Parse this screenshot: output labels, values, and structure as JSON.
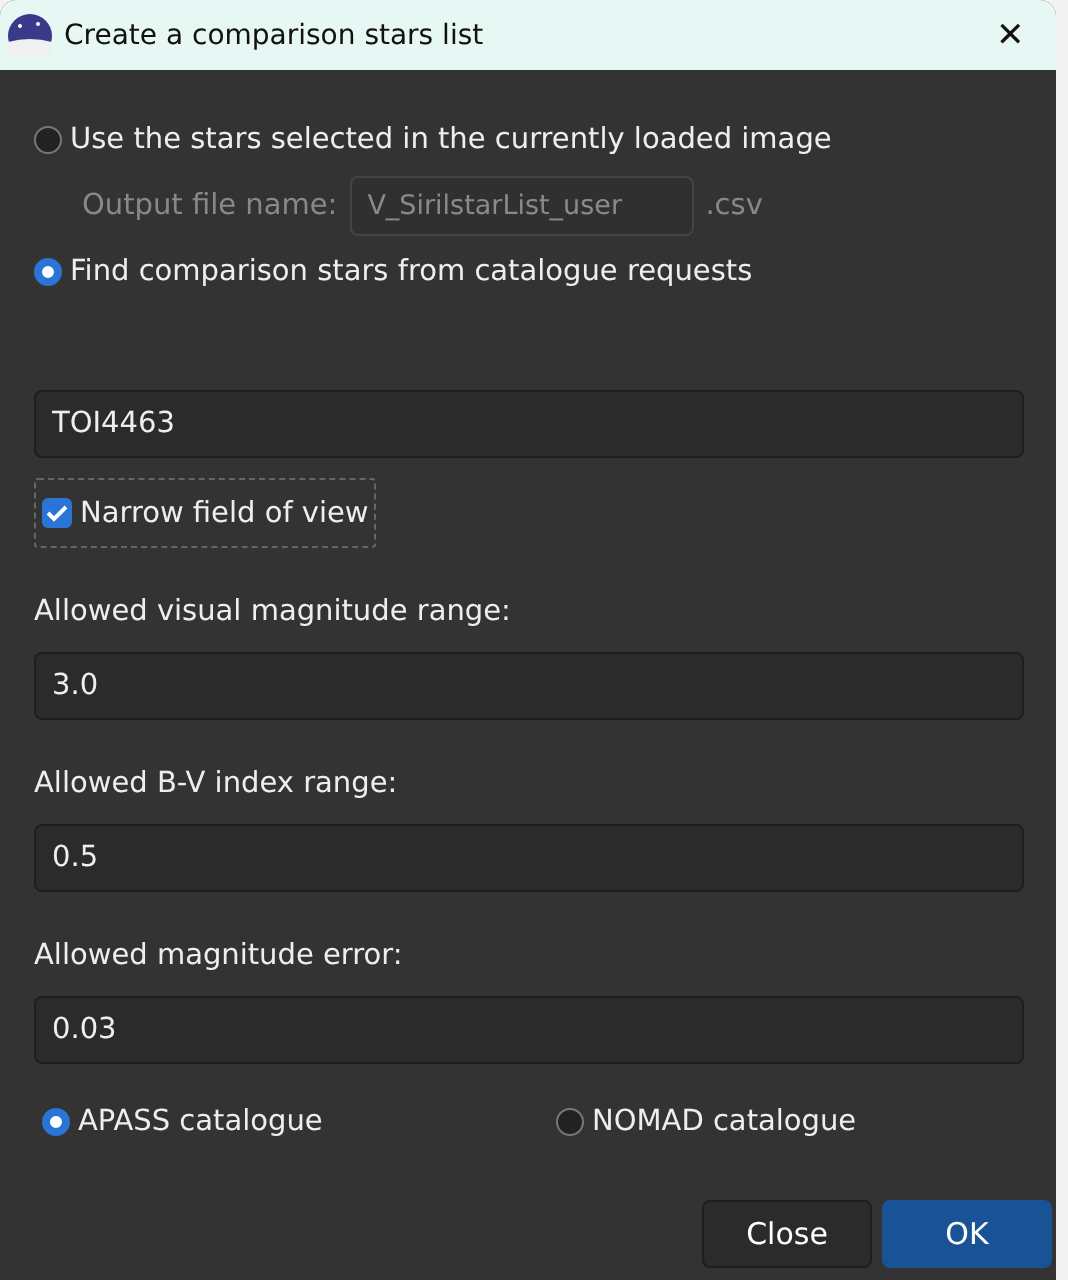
{
  "window": {
    "title": "Create a comparison stars list",
    "close": "✕"
  },
  "source_options": [
    {
      "label": "Use the stars selected in the currently loaded image",
      "selected": false
    },
    {
      "label": "Find comparison stars from catalogue requests",
      "selected": true
    }
  ],
  "output_file": {
    "label": "Output file name:",
    "value": "V_SirilstarList_user",
    "suffix": ".csv",
    "disabled": true
  },
  "target": {
    "value": "TOI4463"
  },
  "narrow_field": {
    "label": "Narrow field of view",
    "checked": true
  },
  "parameters": [
    {
      "label": "Allowed visual magnitude range:",
      "value": "3.0"
    },
    {
      "label": "Allowed B-V index range:",
      "value": "0.5"
    },
    {
      "label": "Allowed magnitude error:",
      "value": "0.03"
    }
  ],
  "catalogues": [
    {
      "label": "APASS catalogue",
      "selected": true
    },
    {
      "label": "NOMAD catalogue",
      "selected": false
    }
  ],
  "buttons": [
    {
      "label": "Close",
      "kind": "normal"
    },
    {
      "label": "OK",
      "kind": "default"
    }
  ]
}
